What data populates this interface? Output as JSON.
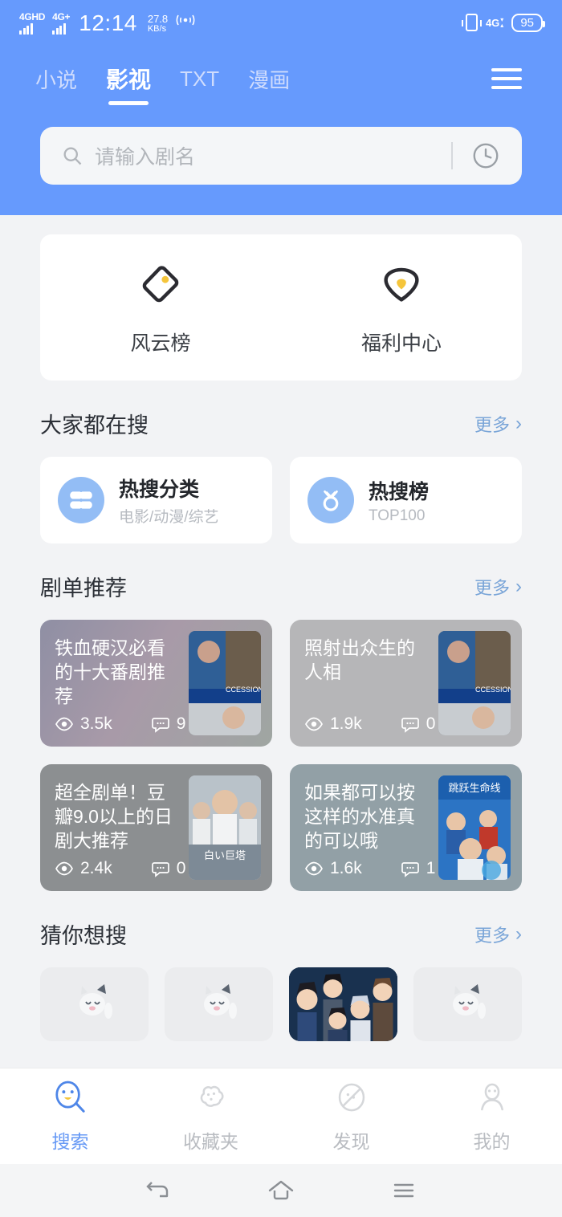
{
  "statusbar": {
    "network1_label": "4GHD",
    "network2_label": "4G+",
    "time": "12:14",
    "speed_value": "27.8",
    "speed_unit": "KB/s",
    "hotspot_icon": "hotspot-icon",
    "vibrate_icon": "vibrate-icon",
    "signal_label": "4G",
    "battery": "95"
  },
  "header": {
    "tabs": [
      {
        "label": "小说",
        "active": false
      },
      {
        "label": "影视",
        "active": true
      },
      {
        "label": "TXT",
        "active": false
      },
      {
        "label": "漫画",
        "active": false
      }
    ],
    "menu_icon": "hamburger-menu-icon",
    "accent_color": "#669afd"
  },
  "search": {
    "placeholder": "请输入剧名",
    "search_icon": "search-icon",
    "history_icon": "history-clock-icon"
  },
  "quick_actions": [
    {
      "label": "风云榜",
      "icon": "tag-icon",
      "dot_color": "#f5c53b"
    },
    {
      "label": "福利中心",
      "icon": "gift-heart-icon",
      "dot_color": "#f5c53b"
    }
  ],
  "hot_search": {
    "section_title": "大家都在搜",
    "more_label": "更多",
    "cards": [
      {
        "title": "热搜分类",
        "subtitle": "电影/动漫/综艺",
        "icon": "grid-flower-icon"
      },
      {
        "title": "热搜榜",
        "subtitle": "TOP100",
        "icon": "medal-icon"
      }
    ]
  },
  "playlists": {
    "section_title": "剧单推荐",
    "more_label": "更多",
    "items": [
      {
        "title": "铁血硬汉必看的十大番剧推荐",
        "views": "3.5k",
        "comments": "9"
      },
      {
        "title": "照射出众生的人相",
        "views": "1.9k",
        "comments": "0"
      },
      {
        "title": "超全剧单！豆瓣9.0以上的日剧大推荐",
        "views": "2.4k",
        "comments": "0"
      },
      {
        "title": "如果都可以按这样的水准真的可以哦",
        "views": "1.6k",
        "comments": "1"
      }
    ]
  },
  "guess": {
    "section_title": "猜你想搜",
    "more_label": "更多",
    "thumbnails": [
      {
        "state": "placeholder",
        "icon": "cat-placeholder-icon"
      },
      {
        "state": "placeholder",
        "icon": "cat-placeholder-icon"
      },
      {
        "state": "loaded",
        "icon": "anime-poster"
      },
      {
        "state": "placeholder",
        "icon": "cat-placeholder-icon"
      }
    ]
  },
  "bottom_nav": [
    {
      "label": "搜索",
      "icon": "search-face-icon",
      "active": true
    },
    {
      "label": "收藏夹",
      "icon": "cloud-favorites-icon",
      "active": false
    },
    {
      "label": "发现",
      "icon": "compass-discover-icon",
      "active": false
    },
    {
      "label": "我的",
      "icon": "person-profile-icon",
      "active": false
    }
  ],
  "system_nav": [
    {
      "icon": "back-icon"
    },
    {
      "icon": "home-icon"
    },
    {
      "icon": "recents-icon"
    }
  ]
}
